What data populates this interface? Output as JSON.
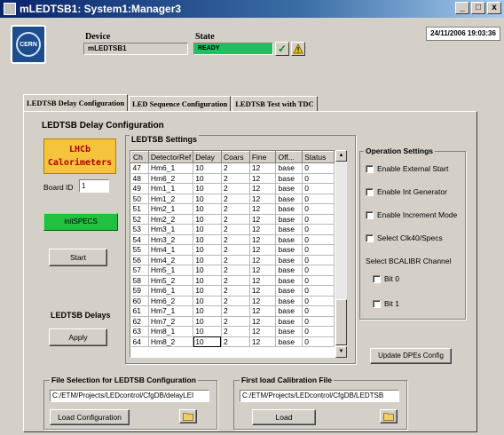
{
  "window": {
    "title": "mLEDTSB1: System1:Manager3",
    "minimize": "_",
    "maximize": "□",
    "close": "x"
  },
  "header": {
    "logo_text": "CERN",
    "device_label": "Device",
    "device_value": "mLEDTSB1",
    "state_label": "State",
    "state_value": "READY",
    "state_color": "#20c060",
    "check_symbol": "✓",
    "datetime": "24/11/2006   19:03:36"
  },
  "tabs": [
    {
      "label": "LEDTSB Delay Configuration",
      "active": true
    },
    {
      "label": "LED Sequence Configuration",
      "active": false
    },
    {
      "label": "LEDTSB Test with TDC",
      "active": false
    }
  ],
  "panel": {
    "title": "LEDTSB Delay Configuration",
    "lhcb_line1": "LHCb",
    "lhcb_line2": "Calorimeters",
    "board_id_label": "Board ID",
    "board_id_value": "1",
    "init_specs_label": "initSPECS",
    "start_label": "Start",
    "delays_label": "LEDTSB Delays",
    "apply_label": "Apply"
  },
  "settings": {
    "title": "LEDTSB Settings",
    "columns": [
      "Ch",
      "DetectorRef",
      "Delay",
      "Coars",
      "Fine",
      "Off...",
      "Status"
    ],
    "rows": [
      [
        "47",
        "Hm6_1",
        "10",
        "2",
        "12",
        "base",
        "0"
      ],
      [
        "48",
        "Hm6_2",
        "10",
        "2",
        "12",
        "base",
        "0"
      ],
      [
        "49",
        "Hm1_1",
        "10",
        "2",
        "12",
        "base",
        "0"
      ],
      [
        "50",
        "Hm1_2",
        "10",
        "2",
        "12",
        "base",
        "0"
      ],
      [
        "51",
        "Hm2_1",
        "10",
        "2",
        "12",
        "base",
        "0"
      ],
      [
        "52",
        "Hm2_2",
        "10",
        "2",
        "12",
        "base",
        "0"
      ],
      [
        "53",
        "Hm3_1",
        "10",
        "2",
        "12",
        "base",
        "0"
      ],
      [
        "54",
        "Hm3_2",
        "10",
        "2",
        "12",
        "base",
        "0"
      ],
      [
        "55",
        "Hm4_1",
        "10",
        "2",
        "12",
        "base",
        "0"
      ],
      [
        "56",
        "Hm4_2",
        "10",
        "2",
        "12",
        "base",
        "0"
      ],
      [
        "57",
        "Hm5_1",
        "10",
        "2",
        "12",
        "base",
        "0"
      ],
      [
        "58",
        "Hm5_2",
        "10",
        "2",
        "12",
        "base",
        "0"
      ],
      [
        "59",
        "Hm6_1",
        "10",
        "2",
        "12",
        "base",
        "0"
      ],
      [
        "60",
        "Hm6_2",
        "10",
        "2",
        "12",
        "base",
        "0"
      ],
      [
        "61",
        "Hm7_1",
        "10",
        "2",
        "12",
        "base",
        "0"
      ],
      [
        "62",
        "Hm7_2",
        "10",
        "2",
        "12",
        "base",
        "0"
      ],
      [
        "63",
        "Hm8_1",
        "10",
        "2",
        "12",
        "base",
        "0"
      ],
      [
        "64",
        "Hm8_2",
        "10",
        "2",
        "12",
        "base",
        "0"
      ]
    ],
    "scroll_up": "▲",
    "scroll_down": "▼"
  },
  "operation": {
    "title": "Operation Settings",
    "options": [
      "Enable External Start",
      "Enable Int Generator",
      "Enable Increment Mode",
      "Select Clk40/Specs"
    ],
    "bcalibr_label": "Select BCALIBR Channel",
    "bits": [
      "Bit 0",
      "Bit 1"
    ]
  },
  "update_label": "Update DPEs Config",
  "file_selection": {
    "title": "File Selection for LEDTSB Configuration",
    "path": "C:/ETM/Projects/LEDcontrol/CfgDB/delayLEI",
    "button_label": "Load Configuration"
  },
  "calibration": {
    "title": "First load Calibration File",
    "path": "C:/ETM/Projects/LEDcontrol/CfgDB/LEDTSB",
    "button_label": "Load"
  }
}
